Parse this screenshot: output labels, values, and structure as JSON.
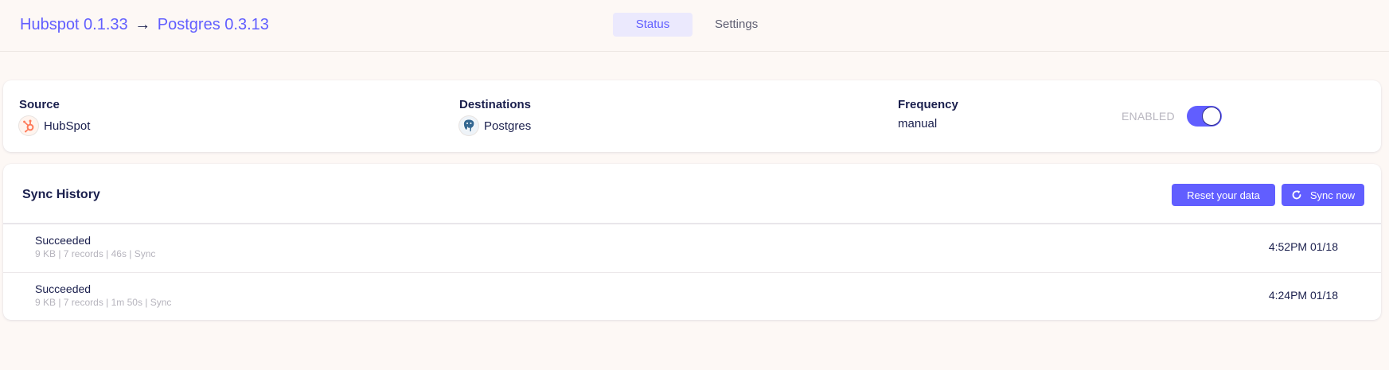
{
  "header": {
    "source_title": "Hubspot 0.1.33",
    "arrow": "→",
    "destination_title": "Postgres 0.3.13",
    "tabs": [
      {
        "label": "Status",
        "active": true
      },
      {
        "label": "Settings",
        "active": false
      }
    ]
  },
  "summary": {
    "source_label": "Source",
    "source_value": "HubSpot",
    "destinations_label": "Destinations",
    "destination_value": "Postgres",
    "frequency_label": "Frequency",
    "frequency_value": "manual",
    "enabled_label": "ENABLED",
    "enabled": true
  },
  "history": {
    "title": "Sync History",
    "reset_label": "Reset your data",
    "sync_label": "Sync now",
    "rows": [
      {
        "status": "Succeeded",
        "meta": "9 KB | 7 records | 46s | Sync",
        "time": "4:52PM 01/18"
      },
      {
        "status": "Succeeded",
        "meta": "9 KB | 7 records | 1m 50s | Sync",
        "time": "4:24PM 01/18"
      }
    ]
  },
  "colors": {
    "accent": "#615eff",
    "text": "#1a1f4d",
    "background": "#fdf8f5",
    "hubspot": "#ff7a59",
    "postgres": "#336791"
  }
}
